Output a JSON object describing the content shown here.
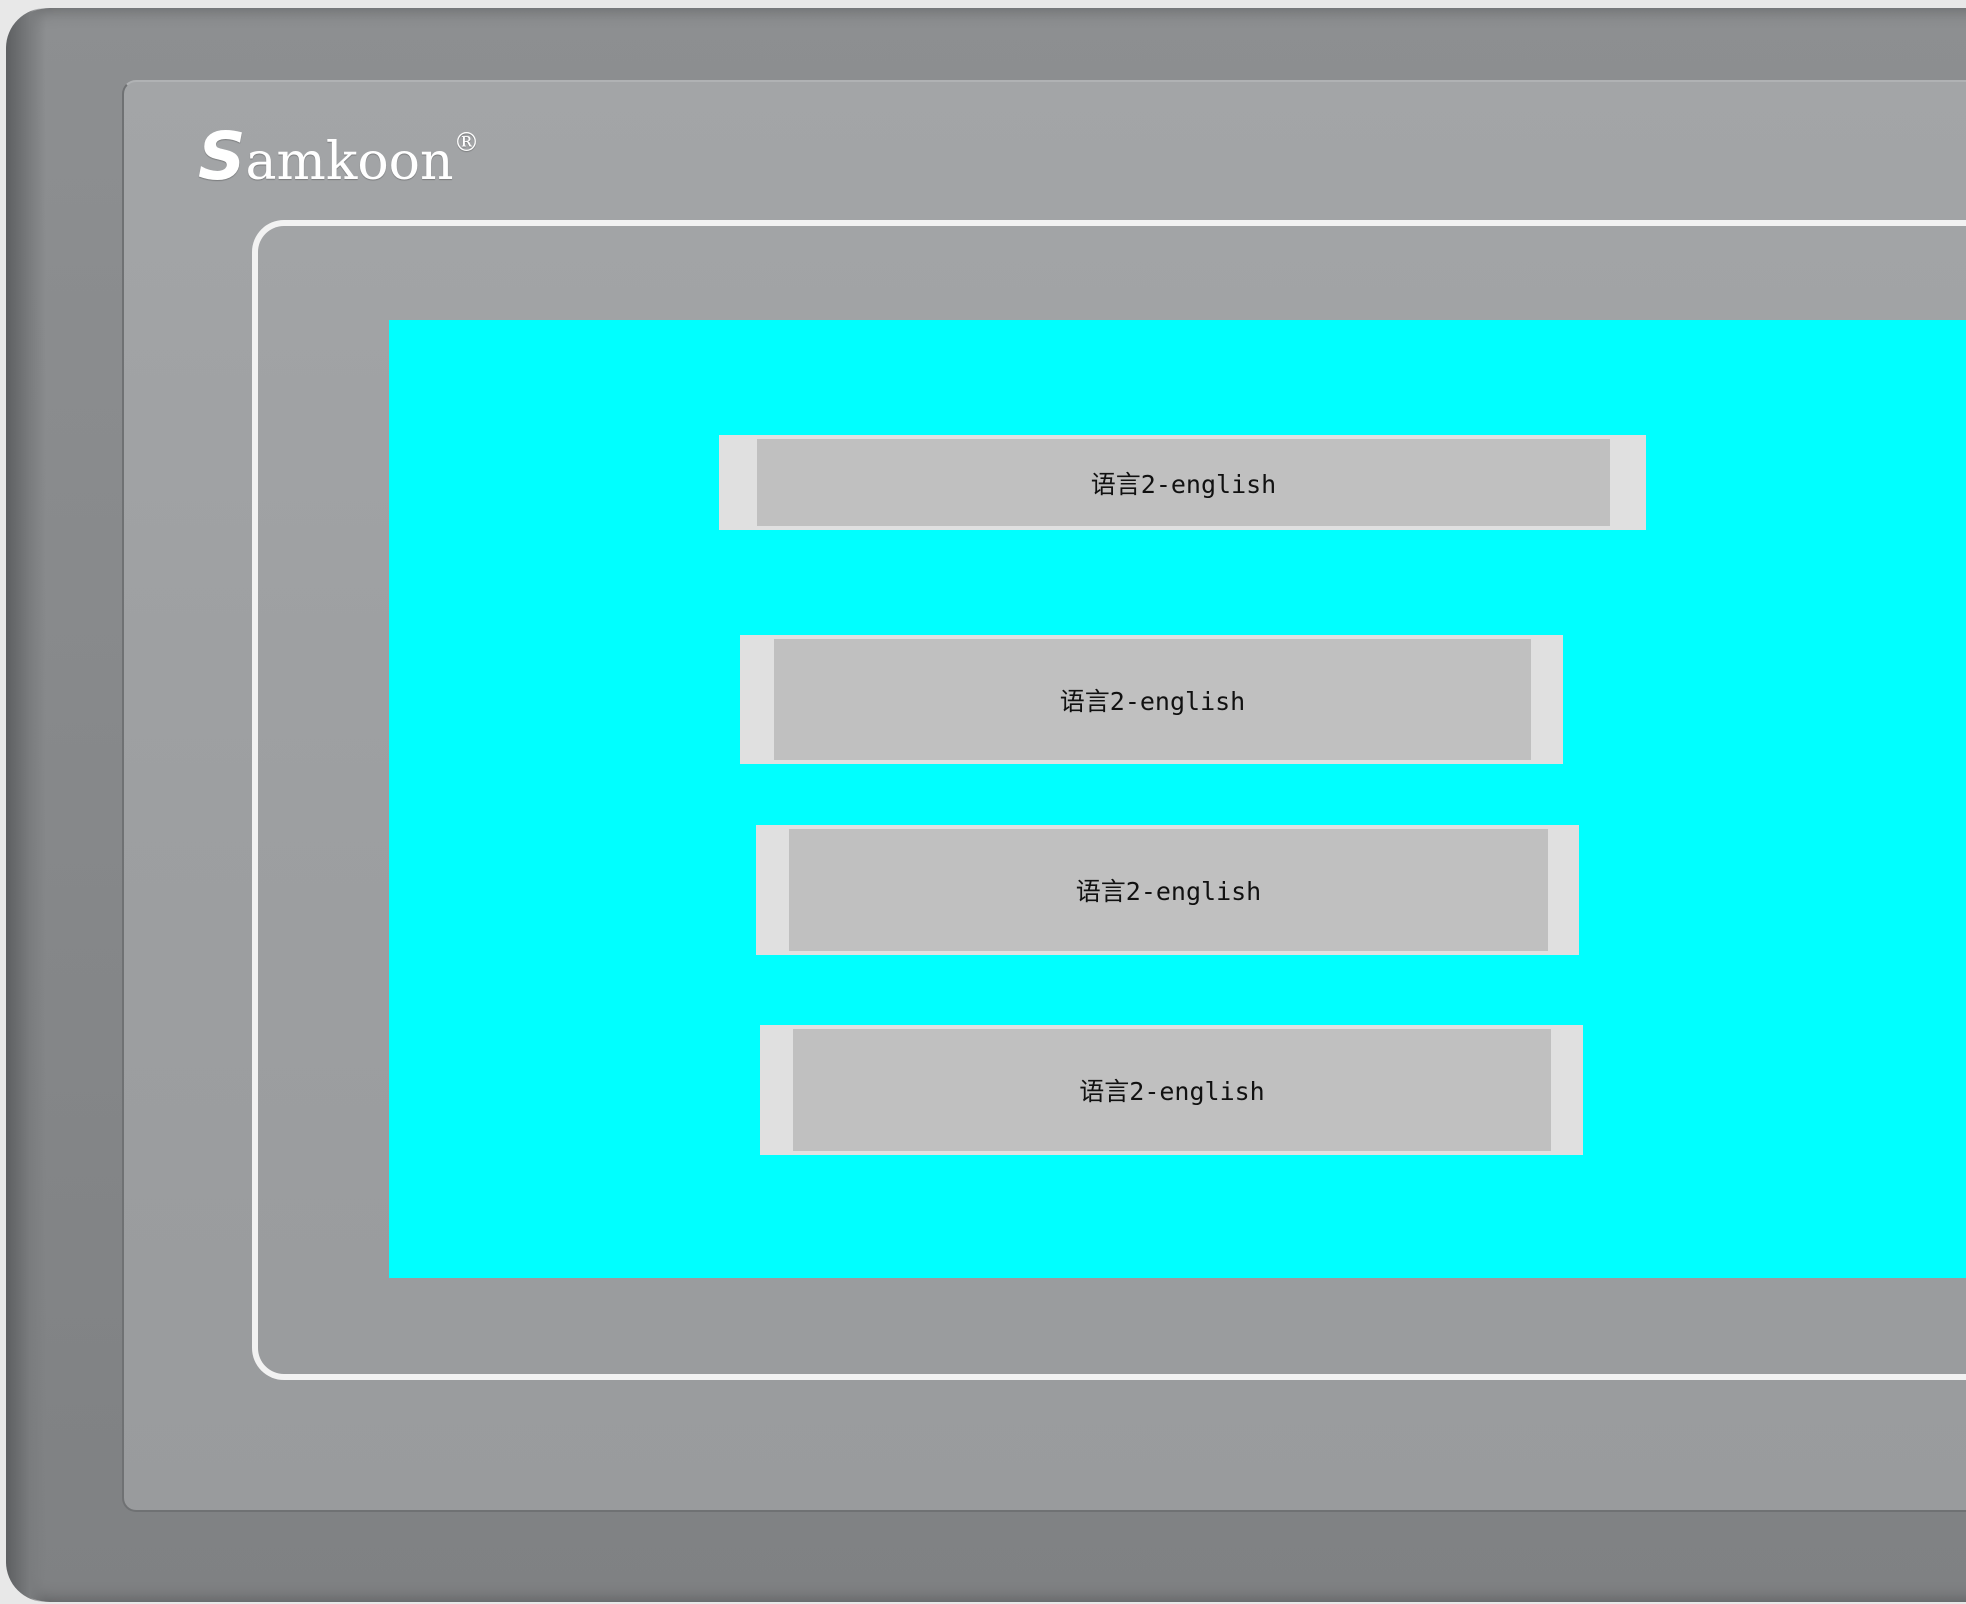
{
  "device": {
    "brand": "Samkoon",
    "brand_initial": "S",
    "brand_rest": "amkoon",
    "registered_mark": "®"
  },
  "screen": {
    "background_color": "#00ffff",
    "buttons": [
      {
        "label": "语言2-english"
      },
      {
        "label": "语言2-english"
      },
      {
        "label": "语言2-english"
      },
      {
        "label": "语言2-english"
      }
    ]
  }
}
